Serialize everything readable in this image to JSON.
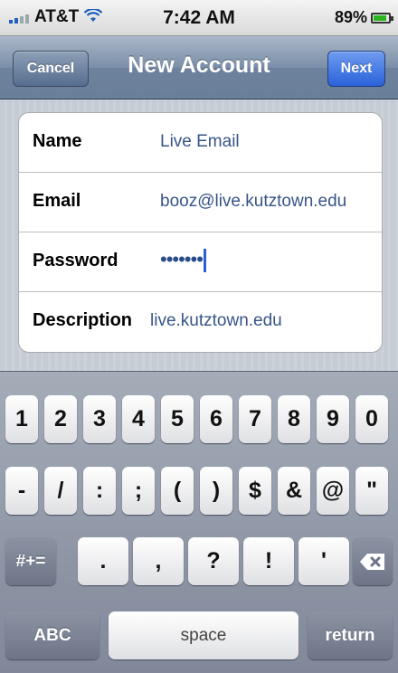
{
  "status_bar": {
    "carrier": "AT&T",
    "time": "7:42 AM",
    "battery": "89%",
    "battery_level": 0.89,
    "signal_icon": "signal-bars-icon",
    "wifi_icon": "wifi-icon",
    "battery_icon": "battery-icon"
  },
  "navbar": {
    "title": "New Account",
    "cancel_label": "Cancel",
    "next_label": "Next"
  },
  "form": {
    "fields": [
      {
        "label": "Name",
        "value": "Live Email"
      },
      {
        "label": "Email",
        "value": "booz@live.kutztown.edu"
      },
      {
        "label": "Password",
        "value": "•••••••"
      },
      {
        "label": "Description",
        "value": "live.kutztown.edu"
      }
    ]
  },
  "keyboard": {
    "row1": [
      "1",
      "2",
      "3",
      "4",
      "5",
      "6",
      "7",
      "8",
      "9",
      "0"
    ],
    "row2": [
      "-",
      "/",
      ":",
      ";",
      "(",
      ")",
      "$",
      "&",
      "@",
      "\""
    ],
    "row3": {
      "shift_label": "#+=",
      "keys": [
        ".",
        ",",
        "?",
        "!",
        "'"
      ],
      "delete_icon": "backspace-icon"
    },
    "row4": {
      "abc_label": "ABC",
      "space_label": "space",
      "return_label": "return"
    }
  },
  "colors": {
    "accent_blue": "#2a62d9",
    "navbar": "#6d829d",
    "field_value": "#385487"
  }
}
